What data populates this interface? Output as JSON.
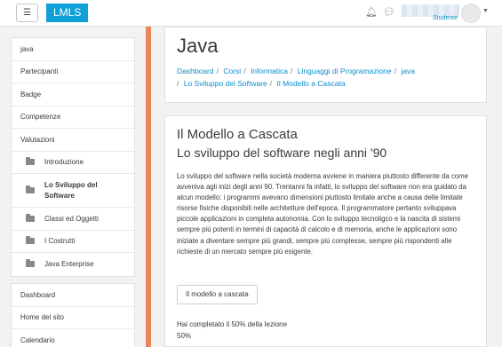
{
  "navbar": {
    "brand": "LMLS",
    "user_role": "Studente",
    "icons": [
      "menu-icon",
      "bell-icon",
      "chat-icon",
      "avatar",
      "caret-down-icon"
    ]
  },
  "sidebar": {
    "items": [
      {
        "label": "java"
      },
      {
        "label": "Partecipanti"
      },
      {
        "label": "Badge"
      },
      {
        "label": "Competenze"
      },
      {
        "label": "Valutazioni"
      }
    ],
    "sections": [
      {
        "label": "Introduzione"
      },
      {
        "label": "Lo Sviluppo del Software",
        "active": true
      },
      {
        "label": "Classi ed Oggetti"
      },
      {
        "label": "I Costrutti"
      },
      {
        "label": "Java Enterprise"
      }
    ],
    "bottom_items": [
      {
        "label": "Dashboard"
      },
      {
        "label": "Home del sito"
      },
      {
        "label": "Calendario"
      }
    ]
  },
  "header": {
    "title": "Java",
    "breadcrumb": [
      "Dashboard",
      "Corsi",
      "Informatica",
      "Linguaggi di Programazione",
      "java",
      "Lo Sviluppo del Software",
      "Il Modello a Cascata"
    ]
  },
  "lesson": {
    "title": "Il Modello a Cascata",
    "subtitle": "Lo sviluppo del software negli anni '90",
    "body": "Lo sviluppo del software nella società moderna avviene in maniera piuttosto differente da come avveniva agli inizi degli anni 90. Trentanni fa infatti, lo sviluppo del software non era guidato da alcun modello: i programmi avevano dimensioni piuttosto limitate anche a causa delle limitate risorse fisiche disponibili nelle architetture dell'epoca. Il programmatore pertanto sviluppava piccole applicazioni in completa autonomia. Con lo sviluppo tecnoligco e la nascita di sistemi sempre più potenti in termini di capacità di calcolo e di memoria, anche le applicazioni sono iniziate a diventare sempre più grandi, sempre più complesse, sempre più rispondenti alle richieste di un mercato sempre più esigente.",
    "button_label": "Il modello a cascata",
    "progress_text": "Hai completato il 50% della lezione",
    "progress_value": "50%"
  },
  "colors": {
    "brand": "#0fa0d8",
    "link": "#0a8ec9",
    "accent_bar": "#e8855d"
  }
}
